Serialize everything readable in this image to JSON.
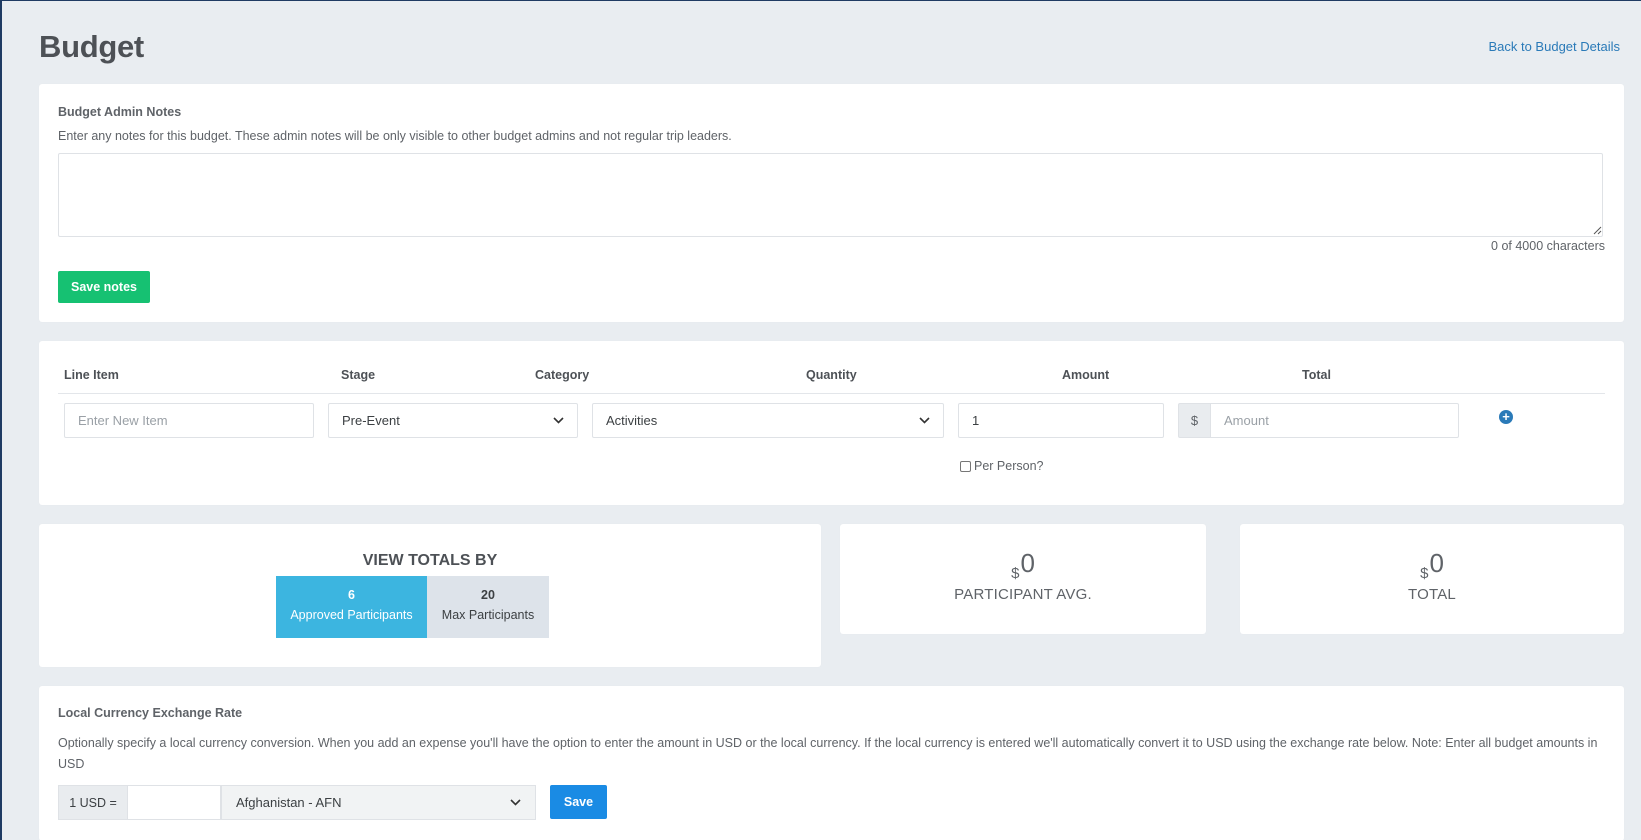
{
  "header": {
    "title": "Budget",
    "back_link": "Back to Budget Details"
  },
  "notes": {
    "title": "Budget Admin Notes",
    "help": "Enter any notes for this budget. These admin notes will be only visible to other budget admins and not regular trip leaders.",
    "value": "",
    "char_count": "0 of 4000 characters",
    "save_label": "Save notes"
  },
  "line_items": {
    "headers": [
      "Line Item",
      "Stage",
      "Category",
      "Quantity",
      "Amount",
      "Total"
    ],
    "item_placeholder": "Enter New Item",
    "stage_value": "Pre-Event",
    "category_value": "Activities",
    "quantity_value": "1",
    "currency_symbol": "$",
    "amount_placeholder": "Amount",
    "per_person_label": "Per Person?",
    "per_person_checked": false,
    "add_icon": "plus-circle-icon"
  },
  "totals": {
    "view_title": "VIEW TOTALS BY",
    "approved_count": "6",
    "approved_label": "Approved Participants",
    "max_count": "20",
    "max_label": "Max Participants",
    "active_toggle": "approved",
    "avg_currency": "$",
    "avg_value": "0",
    "avg_label": "PARTICIPANT AVG.",
    "total_currency": "$",
    "total_value": "0",
    "total_label": "TOTAL"
  },
  "currency": {
    "title": "Local Currency Exchange Rate",
    "help": "Optionally specify a local currency conversion. When you add an expense you'll have the option to enter the amount in USD or the local currency. If the local currency is entered we'll automatically convert it to USD using the exchange rate below. Note: Enter all budget amounts in USD",
    "usd_label": "1 USD =",
    "rate_value": "",
    "country_value": "Afghanistan - AFN",
    "save_label": "Save"
  },
  "colors": {
    "background": "#e9edf1",
    "save_notes": "#16c172",
    "toggle_active": "#3cb5e0",
    "save_button": "#1a8be4",
    "link": "#2a7ab8"
  }
}
